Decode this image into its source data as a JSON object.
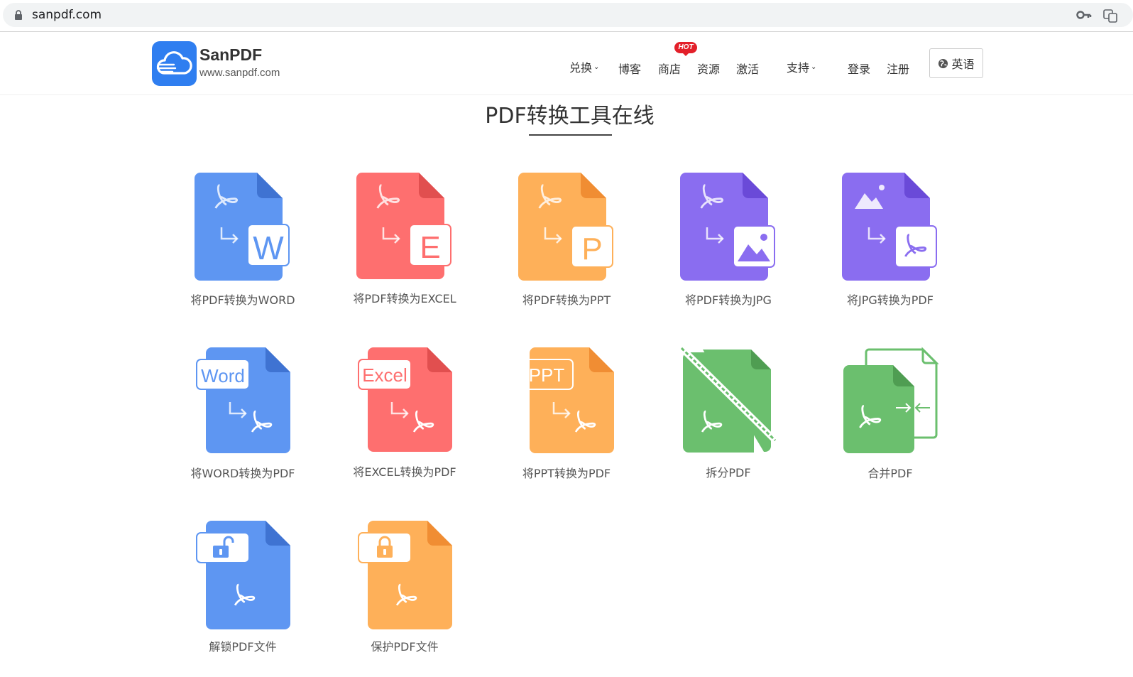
{
  "browser": {
    "url": "sanpdf.com"
  },
  "header": {
    "brand": "SanPDF",
    "brand_url": "www.sanpdf.com",
    "nav": {
      "convert": "兑换",
      "blog": "博客",
      "store": "商店",
      "store_badge": "HOT",
      "resources": "资源",
      "activate": "激活",
      "support": "支持",
      "login": "登录",
      "register": "注册"
    },
    "language": "英语"
  },
  "page_title": "PDF转换工具在线",
  "colors": {
    "blue": "#5e96f2",
    "red": "#fe6f6f",
    "orange": "#feb059",
    "purple": "#8a6df0",
    "green": "#6bbf6e",
    "badge": "#e3202a"
  },
  "tools": [
    {
      "label": "将PDF转换为WORD",
      "icon": "pdf-to-word-icon",
      "color": "blue"
    },
    {
      "label": "将PDF转换为EXCEL",
      "icon": "pdf-to-excel-icon",
      "color": "red"
    },
    {
      "label": "将PDF转换为PPT",
      "icon": "pdf-to-ppt-icon",
      "color": "orange"
    },
    {
      "label": "将PDF转换为JPG",
      "icon": "pdf-to-jpg-icon",
      "color": "purple"
    },
    {
      "label": "将JPG转换为PDF",
      "icon": "jpg-to-pdf-icon",
      "color": "purple"
    },
    {
      "label": "将WORD转换为PDF",
      "icon": "word-to-pdf-icon",
      "color": "blue"
    },
    {
      "label": "将EXCEL转换为PDF",
      "icon": "excel-to-pdf-icon",
      "color": "red"
    },
    {
      "label": "将PPT转换为PDF",
      "icon": "ppt-to-pdf-icon",
      "color": "orange"
    },
    {
      "label": "拆分PDF",
      "icon": "split-pdf-icon",
      "color": "green"
    },
    {
      "label": "合并PDF",
      "icon": "merge-pdf-icon",
      "color": "green"
    },
    {
      "label": "解锁PDF文件",
      "icon": "unlock-pdf-icon",
      "color": "blue"
    },
    {
      "label": "保护PDF文件",
      "icon": "protect-pdf-icon",
      "color": "orange"
    }
  ],
  "icon_text": {
    "word_letter": "W",
    "excel_letter": "E",
    "ppt_letter": "P",
    "word_tag": "Word",
    "excel_tag": "Excel",
    "ppt_tag": "PPT"
  }
}
